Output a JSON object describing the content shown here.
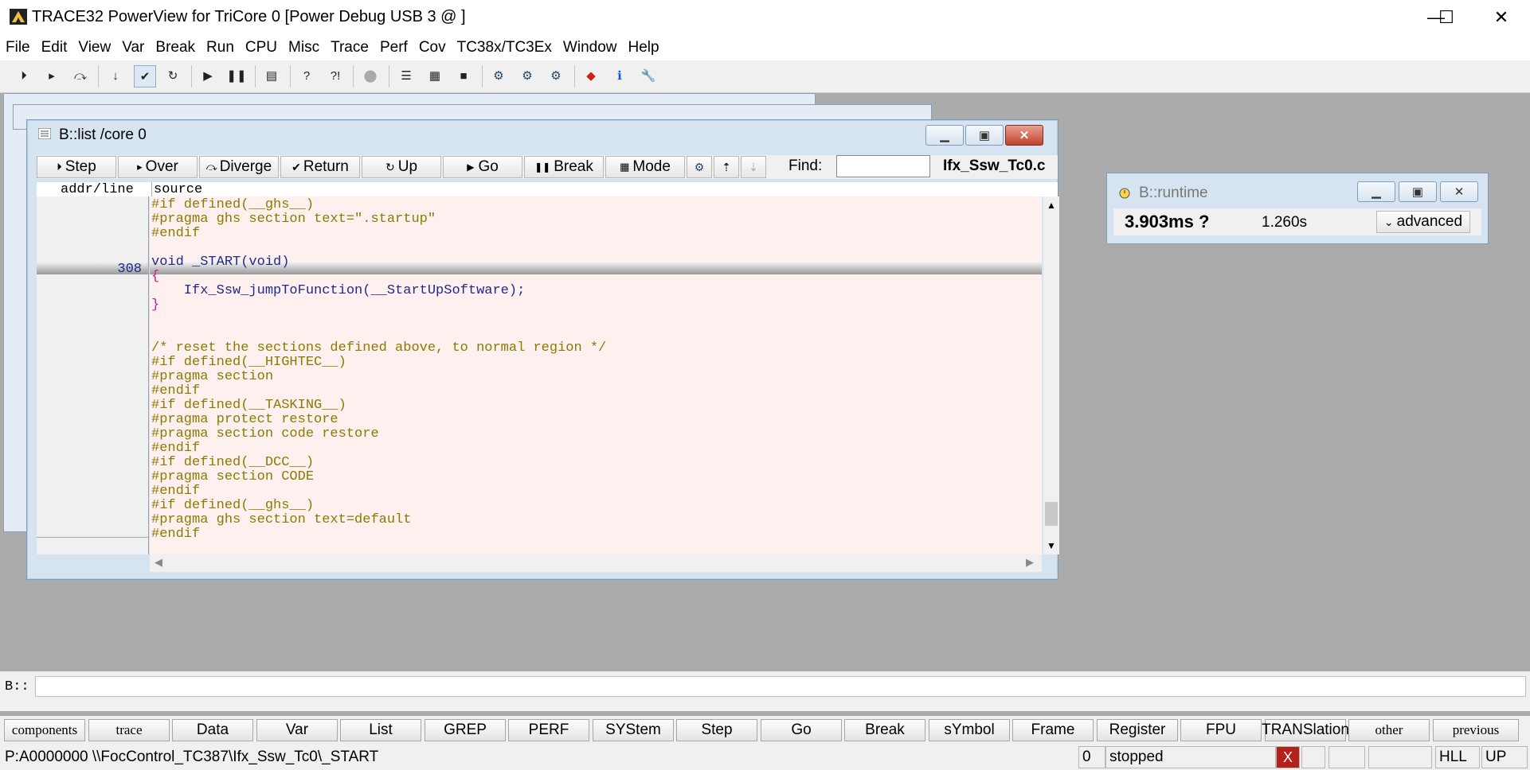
{
  "app": {
    "title": "TRACE32 PowerView for TriCore 0 [Power Debug USB 3 @ ]",
    "minimize_glyph": "—",
    "maximize_glyph": "☐",
    "close_glyph": "✕"
  },
  "menu": [
    "File",
    "Edit",
    "View",
    "Var",
    "Break",
    "Run",
    "CPU",
    "Misc",
    "Trace",
    "Perf",
    "Cov",
    "TC38x/TC3Ex",
    "Window",
    "Help"
  ],
  "toolbar_icons": [
    "step-icon",
    "step-over-icon",
    "step-diverge-icon",
    "step-into-icon",
    "return-icon",
    "up-icon",
    "go-icon",
    "break-icon",
    "list-icon",
    "help-icon",
    "context-help-icon",
    "stop-icon",
    "register-icon",
    "memory-icon",
    "stack-icon",
    "var-watch-icon",
    "var-local-icon",
    "var-frame-icon",
    "device-icon",
    "info-icon",
    "settings-icon"
  ],
  "list_window": {
    "title": "B::list /core 0",
    "buttons": {
      "step": "Step",
      "over": "Over",
      "diverge": "Diverge",
      "return": "Return",
      "up": "Up",
      "go": "Go",
      "break": "Break",
      "mode": "Mode"
    },
    "find_label": "Find:",
    "find_value": "",
    "file_name": "Ifx_Ssw_Tc0.c",
    "col_addr": "addr/line",
    "col_source": "source",
    "current_line_number": "308",
    "source_lines": [
      "#if defined(__ghs__)",
      "#pragma ghs section text=\".startup\"",
      "#endif",
      "",
      "void _START(void)",
      "{",
      "    Ifx_Ssw_jumpToFunction(__StartUpSoftware);",
      "}",
      "",
      "",
      "/* reset the sections defined above, to normal region */",
      "#if defined(__HIGHTEC__)",
      "#pragma section",
      "#endif",
      "#if defined(__TASKING__)",
      "#pragma protect restore",
      "#pragma section code restore",
      "#endif",
      "#if defined(__DCC__)",
      "#pragma section CODE",
      "#endif",
      "#if defined(__ghs__)",
      "#pragma ghs section text=default",
      "#endif"
    ]
  },
  "runtime_window": {
    "title": "B::runtime",
    "value": "3.903ms ?",
    "secondary": "1.260s",
    "advanced": "advanced"
  },
  "command": {
    "prompt": "B::",
    "value": ""
  },
  "softkeys": [
    "components",
    "trace",
    "Data",
    "Var",
    "List",
    "GREP",
    "PERF",
    "SYStem",
    "Step",
    "Go",
    "Break",
    "sYmbol",
    "Frame",
    "Register",
    "FPU",
    "TRANSlation",
    "other",
    "previous"
  ],
  "status": {
    "address": "P:A0000000  \\\\FocControl_TC387\\Ifx_Ssw_Tc0\\_START",
    "count": "0",
    "state": "stopped",
    "error": "X",
    "mode": "HLL",
    "direction": "UP"
  },
  "colors": {
    "source_text": "#8a7b00",
    "keyword_text": "#1f2a8a",
    "bracket_text": "#d0198a",
    "source_bg": "#fdf0ef",
    "error_bg": "#b3211a"
  }
}
